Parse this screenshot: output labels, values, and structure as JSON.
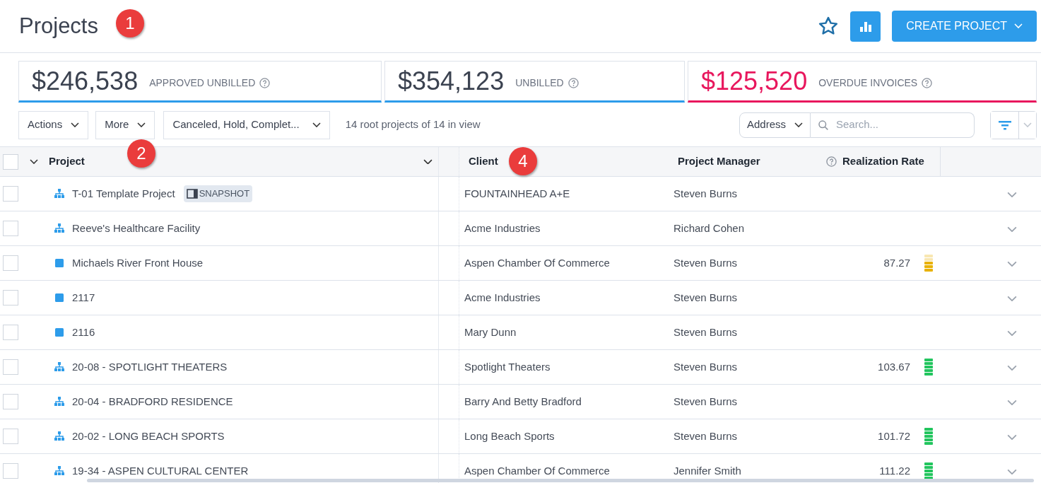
{
  "page": {
    "title": "Projects",
    "create_button": "CREATE PROJECT"
  },
  "stats": [
    {
      "value": "$246,538",
      "label": "APPROVED UNBILLED",
      "color": "#2d9cea"
    },
    {
      "value": "$354,123",
      "label": "UNBILLED",
      "color": "#2d9cea"
    },
    {
      "value": "$125,520",
      "label": "OVERDUE INVOICES",
      "color": "#e8175d"
    }
  ],
  "toolbar": {
    "actions": "Actions",
    "more": "More",
    "status_filter": "Canceled, Hold, Complet...",
    "summary": "14 root projects of 14 in view",
    "search_scope": "Address",
    "search": {
      "placeholder": "Search..."
    }
  },
  "table": {
    "columns": [
      "Project",
      "Client",
      "Project Manager",
      "Realization Rate"
    ],
    "select_all_checked": false,
    "rows": [
      {
        "kind": "parent",
        "checked": false,
        "name": "T-01 Template Project",
        "tag": "SNAPSHOT",
        "client": "FOUNTAINHEAD A+E",
        "manager": "Steven Burns"
      },
      {
        "kind": "parent",
        "checked": false,
        "name": "Reeve's Healthcare Facility",
        "client": "Acme Industries",
        "manager": "Richard Cohen"
      },
      {
        "kind": "single",
        "checked": false,
        "name": "Michaels River Front House",
        "client": "Aspen Chamber Of Commerce",
        "manager": "Steven Burns",
        "rate": "87.27",
        "meter": {
          "level": 0.6,
          "color": "#e8b100"
        }
      },
      {
        "kind": "single",
        "checked": false,
        "name": "2117",
        "client": "Acme Industries",
        "manager": "Steven Burns"
      },
      {
        "kind": "single",
        "checked": false,
        "name": "2116",
        "client": "Mary Dunn",
        "manager": "Steven Burns"
      },
      {
        "kind": "parent",
        "checked": false,
        "name": "20-08 - SPOTLIGHT THEATERS",
        "client": "Spotlight Theaters",
        "manager": "Steven Burns",
        "rate": "103.67",
        "meter": {
          "level": 1,
          "color": "#22c55e"
        }
      },
      {
        "kind": "parent",
        "checked": false,
        "name": "20-04 - BRADFORD RESIDENCE",
        "client": "Barry And Betty Bradford",
        "manager": "Steven Burns"
      },
      {
        "kind": "parent",
        "checked": false,
        "name": "20-02 - LONG BEACH SPORTS",
        "client": "Long Beach Sports",
        "manager": "Steven Burns",
        "rate": "101.72",
        "meter": {
          "level": 1,
          "color": "#22c55e"
        }
      },
      {
        "kind": "parent",
        "checked": false,
        "name": "19-34 - ASPEN CULTURAL CENTER",
        "client": "Aspen Chamber Of Commerce",
        "manager": "Jennifer Smith",
        "rate": "111.22",
        "meter": {
          "level": 1,
          "color": "#22c55e"
        }
      }
    ]
  },
  "callouts": [
    "1",
    "2",
    "4"
  ]
}
